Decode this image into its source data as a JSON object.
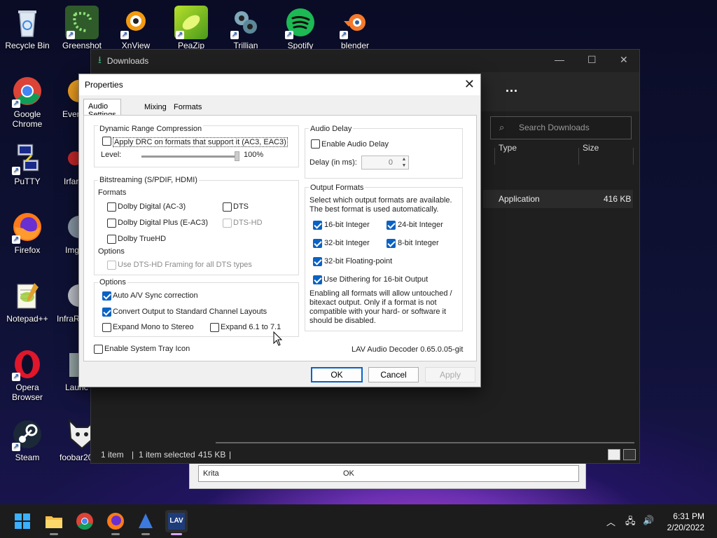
{
  "desktop": {
    "icons": [
      {
        "label": "Recycle Bin",
        "icon": "recycle-bin-icon"
      },
      {
        "label": "Greenshot",
        "icon": "greenshot-icon"
      },
      {
        "label": "XnView",
        "icon": "xnview-icon"
      },
      {
        "label": "PeaZip",
        "icon": "peazip-icon"
      },
      {
        "label": "Trillian",
        "icon": "trillian-icon"
      },
      {
        "label": "Spotify",
        "icon": "spotify-icon"
      },
      {
        "label": "blender",
        "icon": "blender-icon"
      },
      {
        "label": "Google Chrome",
        "icon": "chrome-icon"
      },
      {
        "label": "Ever",
        "icon": "evernote-icon"
      },
      {
        "label": "PuTTY",
        "icon": "putty-icon"
      },
      {
        "label": "Irfar",
        "icon": "irfanview-icon"
      },
      {
        "label": "Firefox",
        "icon": "firefox-icon"
      },
      {
        "label": "Img",
        "icon": "imgburn-icon"
      },
      {
        "label": "Notepad++",
        "icon": "notepadpp-icon"
      },
      {
        "label": "InfraR",
        "icon": "infrarecorder-icon"
      },
      {
        "label": "Opera Browser",
        "icon": "opera-icon"
      },
      {
        "label": "Launc",
        "icon": "launcher-icon"
      },
      {
        "label": "Steam",
        "icon": "steam-icon"
      },
      {
        "label": "foobar20",
        "icon": "foobar-icon"
      }
    ]
  },
  "explorer": {
    "title": "Downloads",
    "more_label": "...",
    "search_placeholder": "Search Downloads",
    "columns": {
      "type": "Type",
      "size": "Size"
    },
    "row": {
      "type": "Application",
      "size": "416 KB"
    },
    "status": {
      "count": "1 item",
      "selected": "1 item selected",
      "size": "415 KB",
      "sep": "|"
    }
  },
  "bg_dialog": {
    "row_name": "Krita",
    "row_status": "OK"
  },
  "properties": {
    "title": "Properties",
    "tabs": [
      "Audio Settings",
      "Mixing",
      "Formats"
    ],
    "drc": {
      "group": "Dynamic Range Compression",
      "apply_label": "Apply DRC on formats that support it (AC3, EAC3)",
      "apply_checked": false,
      "level_label": "Level:",
      "level_value": "100%",
      "level_fraction": 1.0
    },
    "bitstreaming": {
      "group": "Bitstreaming (S/PDIF, HDMI)",
      "formats_label": "Formats",
      "items": [
        {
          "label": "Dolby Digital (AC-3)",
          "checked": false,
          "enabled": true
        },
        {
          "label": "DTS",
          "checked": false,
          "enabled": true
        },
        {
          "label": "Dolby Digital Plus (E-AC3)",
          "checked": false,
          "enabled": true
        },
        {
          "label": "DTS-HD",
          "checked": false,
          "enabled": false
        },
        {
          "label": "Dolby TrueHD",
          "checked": false,
          "enabled": true
        }
      ],
      "options_label": "Options",
      "dtshd_framing": "Use DTS-HD Framing for all DTS types"
    },
    "options": {
      "group": "Options",
      "items": [
        {
          "label": "Auto A/V Sync correction",
          "checked": true
        },
        {
          "label": "Convert Output to Standard Channel Layouts",
          "checked": true
        },
        {
          "label": "Expand Mono to Stereo",
          "checked": false
        },
        {
          "label": "Expand 6.1 to 7.1",
          "checked": false
        }
      ]
    },
    "audio_delay": {
      "group": "Audio Delay",
      "enable_label": "Enable Audio Delay",
      "enable_checked": false,
      "delay_label": "Delay (in ms):",
      "delay_value": "0"
    },
    "output_formats": {
      "group": "Output Formats",
      "description": "Select which output formats are available. The best format is used automatically.",
      "items": [
        {
          "label": "16-bit Integer",
          "checked": true
        },
        {
          "label": "24-bit Integer",
          "checked": true
        },
        {
          "label": "32-bit Integer",
          "checked": true
        },
        {
          "label": "8-bit Integer",
          "checked": true
        },
        {
          "label": "32-bit Floating-point",
          "checked": true
        },
        {
          "label": "Use Dithering for 16-bit Output",
          "checked": true
        }
      ],
      "note": "Enabling all formats will allow untouched / bitexact output. Only if a format is not compatible with your hard- or software it should be disabled."
    },
    "system_tray_label": "Enable System Tray Icon",
    "system_tray_checked": false,
    "version": "LAV Audio Decoder 0.65.0.05-git",
    "buttons": {
      "ok": "OK",
      "cancel": "Cancel",
      "apply": "Apply"
    }
  },
  "taskbar": {
    "items": [
      "start-icon",
      "file-explorer-icon",
      "chrome-icon",
      "firefox-icon",
      "app-icon",
      "lav-icon"
    ],
    "lav_label": "LAV",
    "time": "6:31 PM",
    "date": "2/20/2022"
  }
}
